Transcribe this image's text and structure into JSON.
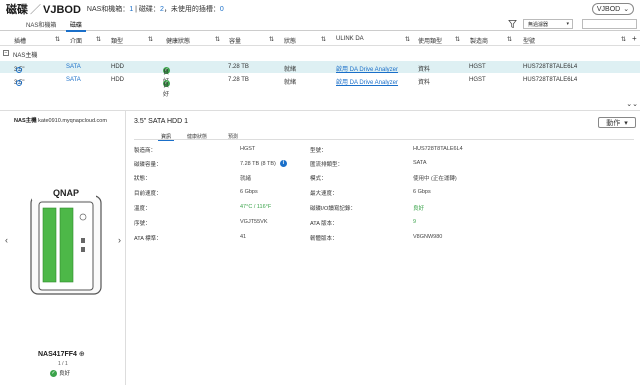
{
  "topbar": {
    "title": "磁碟",
    "separator": "／",
    "title2": "VJBOD",
    "summary_prefix": "NAS和機箱：",
    "nas_count": "1",
    "summary_mid": " | 磁碟：",
    "disk_count": "2",
    "summary_mid2": "，未使用的插槽：",
    "unused_count": "0",
    "vjbod_button": "VJBOD"
  },
  "tabs": [
    "NAS和機箱",
    "磁碟"
  ],
  "filter": {
    "select_label": "無過濾器"
  },
  "table": {
    "columns": [
      "插槽",
      "介面",
      "類型",
      "健康狀態",
      "容量",
      "狀態",
      "ULINK DA",
      "使用類型",
      "製造商",
      "型號"
    ],
    "group_label": "NAS主機",
    "rows": [
      {
        "slot": "3.5\"",
        "slot_num": "1",
        "iface": "SATA",
        "type": "HDD",
        "health": "良好",
        "capacity": "7.28 TB",
        "status": "就緒",
        "ulink": "啟用 DA Drive Analyzer",
        "usage": "資料",
        "maker": "HGST",
        "model": "HUS728T8TALE6L4"
      },
      {
        "slot": "3.5\"",
        "slot_num": "2",
        "iface": "SATA",
        "type": "HDD",
        "health": "良好",
        "capacity": "7.28 TB",
        "status": "就緒",
        "ulink": "啟用 DA Drive Analyzer",
        "usage": "資料",
        "maker": "HGST",
        "model": "HUS728T8TALE6L4"
      }
    ]
  },
  "left": {
    "nas_label": "NAS主機",
    "nas_host": "kate0910.myqnapcloud.com",
    "brand": "QNAP",
    "nas_name": "NAS417FF4",
    "pager": "1 / 1",
    "status": "良好"
  },
  "detail": {
    "title": "3.5\" SATA HDD 1",
    "action": "動作",
    "tabs": [
      "資訊",
      "健康狀態",
      "預測"
    ],
    "left_props": [
      {
        "label": "製造商：",
        "value": "HGST"
      },
      {
        "label": "磁碟容量：",
        "value": "7.28 TB (8 TB)"
      },
      {
        "label": "狀態：",
        "value": "就緒"
      },
      {
        "label": "目前速度：",
        "value": "6 Gbps"
      },
      {
        "label": "溫度：",
        "value": "47°C / 116°F"
      },
      {
        "label": "序號：",
        "value": "VGJT55VK"
      },
      {
        "label": "ATA 標準：",
        "value": "41"
      }
    ],
    "right_props": [
      {
        "label": "型號：",
        "value": "HUS728T8TALE6L4"
      },
      {
        "label": "匯流排類型：",
        "value": "SATA"
      },
      {
        "label": "模式：",
        "value": "使用中 (正在運轉)"
      },
      {
        "label": "最大速度：",
        "value": "6 Gbps"
      },
      {
        "label": "磁碟I/O讀寫記錄：",
        "value": "良好"
      },
      {
        "label": "ATA 版本：",
        "value": "9"
      },
      {
        "label": "韌體版本：",
        "value": "V8GNW980"
      }
    ]
  },
  "colors": {
    "accent": "#1a6fc9",
    "ok": "#3aa34a",
    "selected_row": "#def0f3"
  }
}
